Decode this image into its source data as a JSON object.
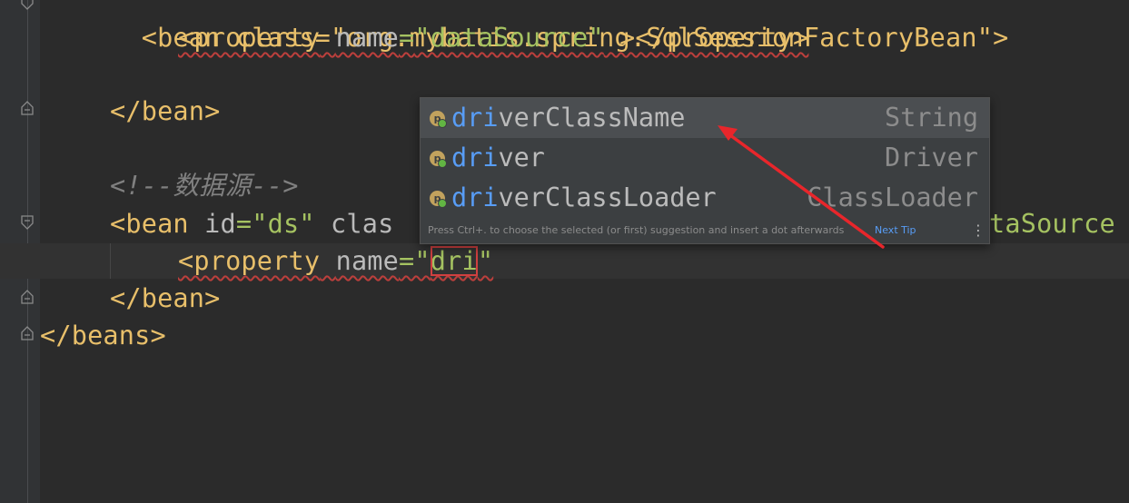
{
  "editor": {
    "line1": "<bean class=\"org.mybatis.spring.SqlSessionFactoryBean\">",
    "line2_open": "<property",
    "line2_attr": "name",
    "line2_val": "\"dataSource\"",
    "line2_close": " ></property>",
    "line3": "</bean>",
    "line4_comment": "<!--数据源-->",
    "line5_start": "<bean",
    "line5_attr": "id",
    "line5_val": "\"ds\"",
    "line5_tail_visible": "clas",
    "line5_right": "taSource",
    "line6_open": "<property",
    "line6_attr": "name",
    "line6_eq": "=\"",
    "line6_typed": "dri",
    "line6_end": "\"",
    "line7": "</bean>",
    "line8": "</beans>"
  },
  "autocomplete": {
    "items": [
      {
        "match": "dri",
        "rest": "verClassName",
        "type": "String"
      },
      {
        "match": "dri",
        "rest": "ver",
        "type": "Driver"
      },
      {
        "match": "dri",
        "rest": "verClassLoader",
        "type": "ClassLoader"
      }
    ],
    "icon_letter": "p",
    "footer_text": "Press Ctrl+. to choose the selected (or first) suggestion and insert a dot afterwards",
    "footer_link": "Next Tip",
    "footer_menu": "⋮"
  },
  "colors": {
    "background": "#2b2b2b",
    "popup_bg": "#3c3f41",
    "match": "#589df6",
    "annotation_arrow": "#e8262b"
  }
}
